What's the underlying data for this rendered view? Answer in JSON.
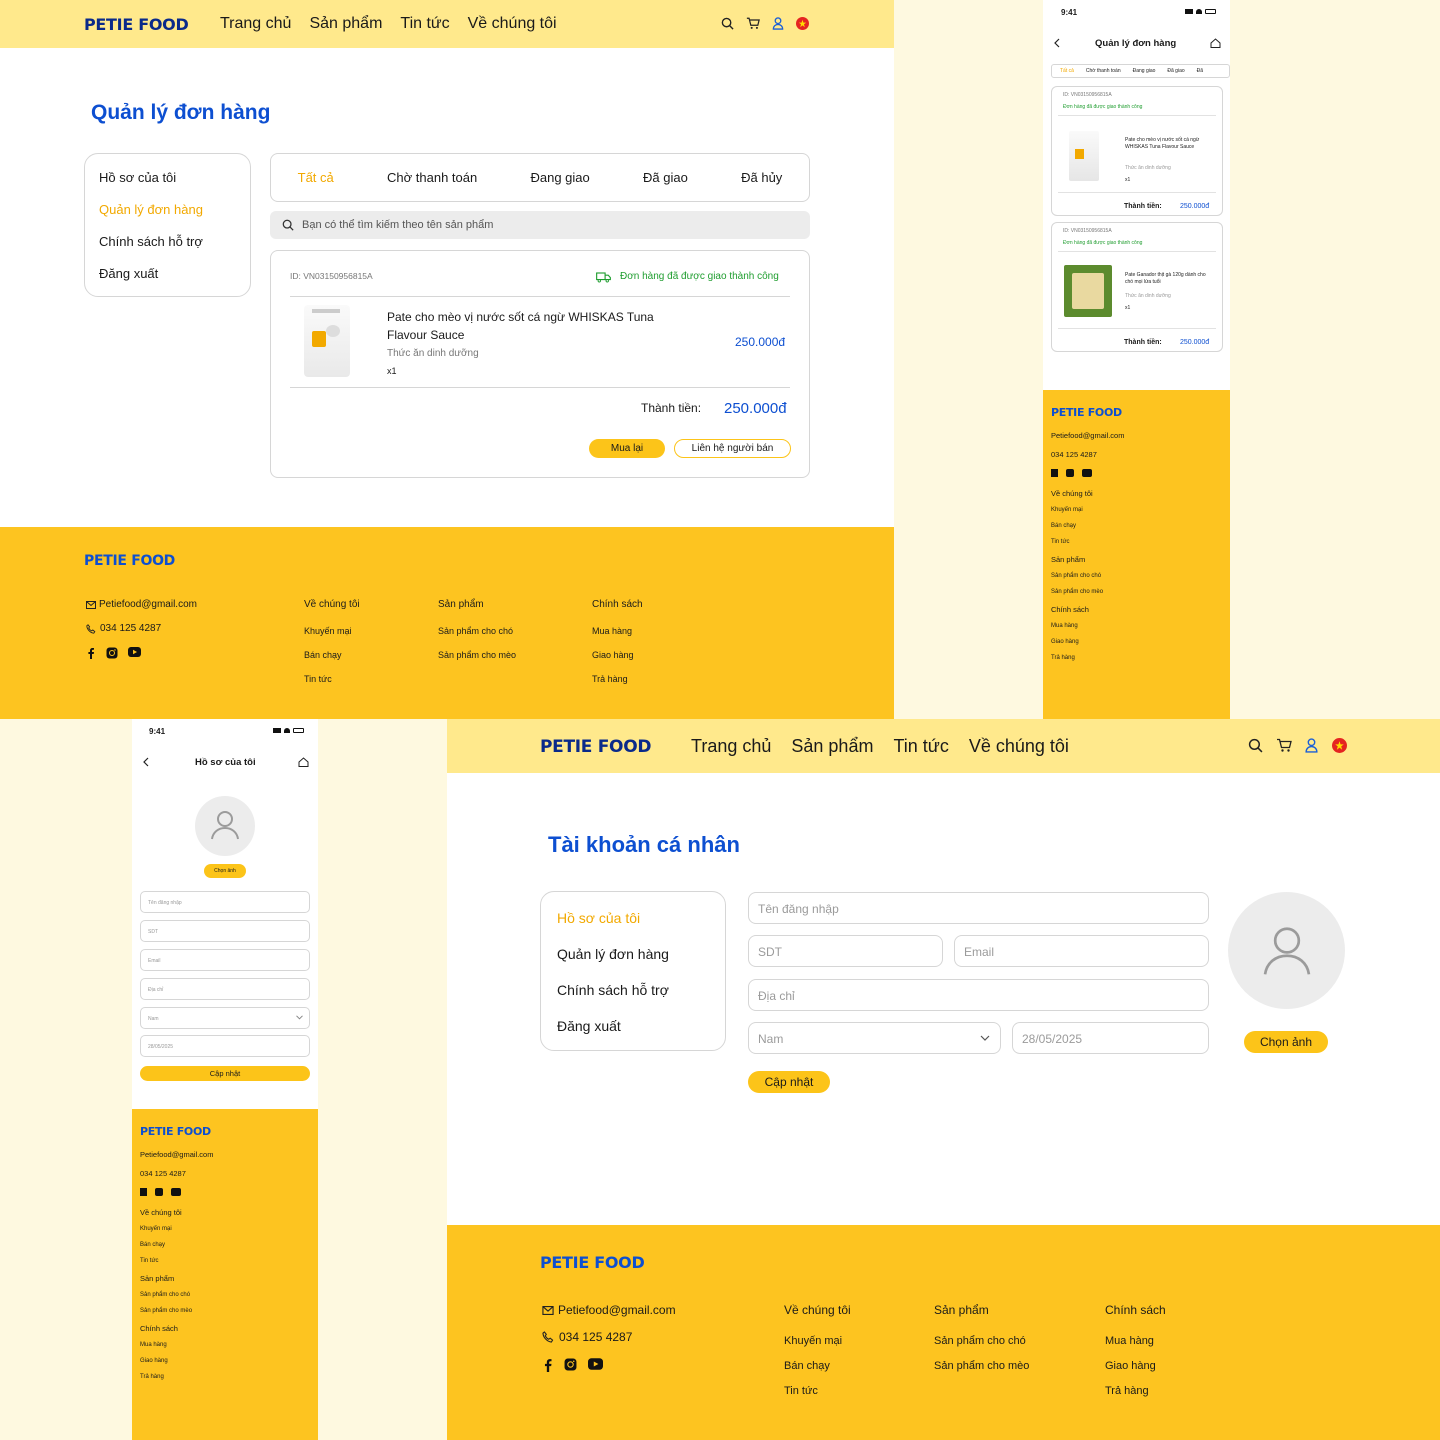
{
  "brand": "PETIE FOOD",
  "nav": [
    "Trang chủ",
    "Sản phẩm",
    "Tin tức",
    "Về chúng tôi"
  ],
  "orders_page": {
    "title": "Quản lý đơn hàng",
    "sidebar": [
      "Hồ sơ của tôi",
      "Quản lý đơn hàng",
      "Chính sách hỗ trợ",
      "Đăng xuất"
    ],
    "tabs": [
      "Tất cả",
      "Chờ thanh toán",
      "Đang giao",
      "Đã giao",
      "Đã hủy"
    ],
    "search_placeholder": "Bạn có thể tìm kiếm theo tên sản phẩm",
    "order": {
      "id": "ID: VN03150956815A",
      "status": "Đơn hàng đã được giao thành công",
      "product_name": "Pate cho mèo vị nước sốt cá ngừ WHISKAS Tuna Flavour Sauce",
      "category": "Thức ăn dinh dưỡng",
      "qty": "x1",
      "price": "250.000đ",
      "total_label": "Thành tiền:",
      "total": "250.000đ",
      "rebuy": "Mua lại",
      "contact": "Liên hệ người bán"
    }
  },
  "mobile_orders": {
    "time": "9:41",
    "title": "Quản lý đơn hàng",
    "tabs": [
      "Tất cả",
      "Chờ thanh toán",
      "Đang giao",
      "Đã giao",
      "Đã"
    ],
    "orders": [
      {
        "id": "ID: VN03150956815A",
        "status": "Đơn hàng đã được giao thành công",
        "name": "Pate cho mèo vị nước sốt cá ngừ WHISKAS Tuna Flavour Sauce",
        "category": "Thức ăn dinh dưỡng",
        "qty": "x1",
        "total_label": "Thành tiền:",
        "total": "250.000đ"
      },
      {
        "id": "ID: VN03150956815A",
        "status": "Đơn hàng đã được giao thành công",
        "name": "Pate Ganador thịt gà 120g dành cho chó mọi lứa tuổi",
        "category": "Thức ăn dinh dưỡng",
        "qty": "x1",
        "total_label": "Thành tiền:",
        "total": "250.000đ"
      }
    ]
  },
  "mobile_profile": {
    "time": "9:41",
    "title": "Hồ sơ của tôi",
    "choose_photo": "Chọn ảnh",
    "fields": [
      "Tên đăng nhập",
      "SDT",
      "Email",
      "Địa chỉ",
      "Nam",
      "28/05/2025"
    ],
    "update": "Cập nhật"
  },
  "profile_page": {
    "title": "Tài khoản cá nhân",
    "sidebar": [
      "Hồ sơ của tôi",
      "Quản lý đơn hàng",
      "Chính sách hỗ trợ",
      "Đăng xuất"
    ],
    "username_ph": "Tên đăng nhập",
    "phone_ph": "SDT",
    "email_ph": "Email",
    "address_ph": "Địa chỉ",
    "gender": "Nam",
    "dob": "28/05/2025",
    "update": "Cập nhật",
    "choose_photo": "Chọn ảnh"
  },
  "footer": {
    "email": "Petiefood@gmail.com",
    "phone": "034 125 4287",
    "about": {
      "title": "Về chúng tôi",
      "items": [
        "Khuyến mại",
        "Bán chạy",
        "Tin tức"
      ]
    },
    "products": {
      "title": "Sản phẩm",
      "items": [
        "Sản phẩm cho chó",
        "Sản phẩm cho mèo"
      ]
    },
    "policy": {
      "title": "Chính sách",
      "items": [
        "Mua hàng",
        "Giao hàng",
        "Trả hàng"
      ]
    }
  },
  "colors": {
    "accent_yellow": "#fcc419",
    "header_yellow": "#ffe98c",
    "footer_yellow": "#fdc420",
    "title_blue": "#0d4fd1",
    "brand_navy": "#0a2a8a",
    "success_green": "#1f9d2f"
  },
  "icons": [
    "search-icon",
    "cart-icon",
    "user-icon",
    "vietnam-flag-icon",
    "truck-icon",
    "mail-icon",
    "phone-icon",
    "facebook-icon",
    "instagram-icon",
    "youtube-icon",
    "back-icon",
    "home-icon",
    "chevron-down-icon"
  ]
}
